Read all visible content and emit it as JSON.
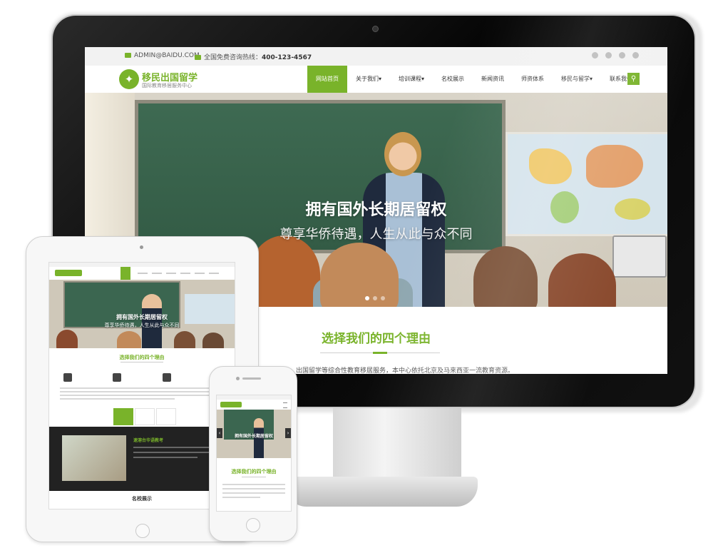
{
  "desktop": {
    "topbar": {
      "email": "ADMIN@BAIDU.COM",
      "hotline_label": "全国免费咨询热线：",
      "hotline_number": "400-123-4567",
      "icons": [
        "weibo-icon",
        "info-icon",
        "qq-icon",
        "cart-icon"
      ]
    },
    "logo": {
      "title": "移民出国留学",
      "subtitle": "国际教育移居服务中心"
    },
    "nav": {
      "items": [
        {
          "label": "网站首页",
          "active": true
        },
        {
          "label": "关于我们▾"
        },
        {
          "label": "培训课程▾"
        },
        {
          "label": "名校展示"
        },
        {
          "label": "新闻资讯"
        },
        {
          "label": "师资体系"
        },
        {
          "label": "移民与留学▾"
        },
        {
          "label": "联系我们"
        }
      ]
    },
    "hero": {
      "title": "拥有国外长期居留权",
      "subtitle": "尊享华侨待遇，人生从此与众不同"
    },
    "section": {
      "title": "选择我们的四个理由",
      "intro": "…辅导、教育移居、出国留学等综合性教育移居服务，本中心依托北京及马来西亚一流教育资源。"
    },
    "colors": {
      "accent": "#79b32a"
    }
  },
  "tablet": {
    "hero_title": "拥有国外长期居留权",
    "hero_subtitle": "尊享华侨待遇，人生从此与众不同",
    "section_title": "选择我们的四个理由",
    "dark_title": "速溶台华语教考",
    "footer_title": "名校展示"
  },
  "phone": {
    "hero_title": "拥有国外长期居留权",
    "section_title": "选择我们的四个理由"
  }
}
